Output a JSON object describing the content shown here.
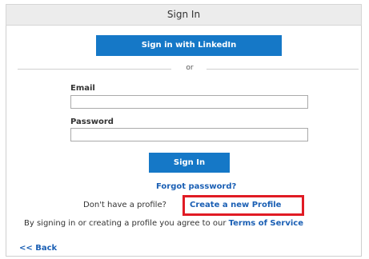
{
  "header": {
    "title": "Sign In"
  },
  "linkedin": {
    "label": "Sign in with LinkedIn"
  },
  "divider": {
    "text": "or"
  },
  "form": {
    "email_label": "Email",
    "email_value": "",
    "password_label": "Password",
    "password_value": "",
    "signin_label": "Sign In"
  },
  "links": {
    "forgot_password": "Forgot password?",
    "no_profile_text": "Don't have a profile?",
    "create_profile": "Create a new Profile",
    "terms_prefix": "By signing in or creating a profile you agree to our ",
    "terms_link": "Terms of Service",
    "back": "<< Back"
  },
  "highlight": {
    "color": "#e01b24"
  },
  "colors": {
    "button": "#1578c7",
    "link": "#1a5fb4"
  }
}
